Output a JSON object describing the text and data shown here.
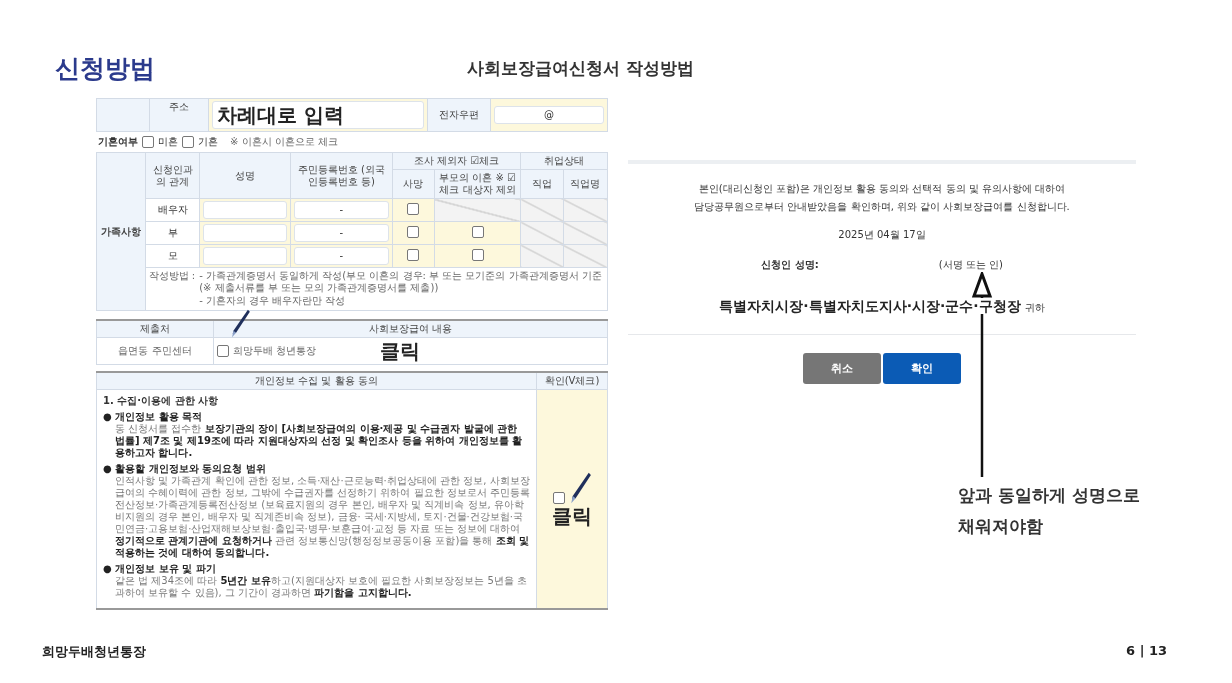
{
  "header": {
    "title": "신청방법",
    "subtitle": "사회보장급여신청서 작성방법"
  },
  "family_form": {
    "address": {
      "label": "주소",
      "annotation": "차례대로 입력"
    },
    "email": {
      "label": "전자우편",
      "value": "@"
    },
    "marital_status": {
      "label": "기혼여부",
      "options": [
        {
          "label": "미혼",
          "checked": false
        },
        {
          "label": "기혼",
          "checked": false
        }
      ],
      "note": "※ 이혼시 이혼으로 체크"
    },
    "section_label": "가족사항",
    "headers": {
      "relation": "신청인과의 관계",
      "name": "성명",
      "id_number": "주민등록번호 (외국인등록번호 등)",
      "exclusion": "조사 제외자 ☑체크",
      "deceased": "사망",
      "divorce": "부모의 이혼 ※ ☑체크 대상자 제외",
      "employment": "취업상태",
      "job": "직업",
      "job_name": "직업명"
    },
    "rows": [
      {
        "relation": "배우자",
        "id_number": "-",
        "deceased_checked": false
      },
      {
        "relation": "부",
        "id_number": "-",
        "deceased_checked": false,
        "divorce_checkbox": {
          "checked": false
        }
      },
      {
        "relation": "모",
        "id_number": "-",
        "deceased_checked": false,
        "divorce_checkbox": {
          "checked": false
        }
      }
    ],
    "note_label": "작성방법 :",
    "notes": [
      "- 가족관계증명서 동일하게 작성(부모 이혼의 경우: 부 또는 모기준의 가족관계증명서 기준 (※ 제출서류를 부 또는 모의 가족관계증명서를 제출))",
      "- 기혼자의 경우 배우자란만 작성"
    ]
  },
  "submission": {
    "headers": [
      "제출처",
      "사회보장급여 내용"
    ],
    "office": "읍면동 주민센터",
    "benefit": {
      "label": "희망두배 청년통장",
      "checked": false
    },
    "annotation": "클릭"
  },
  "consent": {
    "header": "개인정보 수집 및 활용 동의",
    "check_header": "확인(V체크)",
    "section_title": "1. 수집·이용에 관한 사항",
    "items": [
      {
        "bullet": "●",
        "title": "개인정보 활용 목적",
        "text": "동 신청서를 접수한 **보장기관의 장이 [사회보장급여의 이용·제공 및 수급권자 발굴에 관한 법률] 제7조 및 제19조에 따라 지원대상자의 선정 및 확인조사 등을 위하여 개인정보를 활용하고자 합니다.**"
      },
      {
        "bullet": "●",
        "title": "활용할 개인정보와 동의요청 범위",
        "text": "인적사항 및 가족관계 확인에 관한 정보, 소득·재산·근로능력·취업상태에 관한 정보, 사회보장급여의 수혜이력에 관한 정보, 그밖에 수급권자를 선정하기 위하여 필요한 정보로서 주민등록전산정보·가족관계등록전산정보 (보육료지원의 경우 본인, 배우자 및 직계비속 정보, 유아학비지원의 경우 본인, 배우자 및 직계존비속 정보), 금융· 국세·지방세, 토지·건물·건강보험·국민연금·고용보험·산업재해보상보험·출입국·병무·보훈급여·교정 등 자료 또는 정보에 대하여 **정기적으로 관계기관에 요청하거나** 관련 정보통신망(행정정보공동이용 포함)을 통해 **조회 및 적용하는 것에 대하여 동의합니다.**"
      },
      {
        "bullet": "●",
        "title": "개인정보 보유 및 파기",
        "text": "같은 법 제34조에 따라 **5년간 보유**하고(지원대상자 보호에 필요한 사회보장정보는 5년을 초과하여 보유할 수 있음), 그 기간이 경과하면 **파기함을 고지합니다.**"
      }
    ],
    "checked": false,
    "annotation": "클릭"
  },
  "application": {
    "statement": [
      "본인(대리신청인 포함)은 개인정보 활용 동의와 선택적 동의 및 유의사항에 대하여",
      "담당공무원으로부터 안내받았음을 확인하며, 위와 같이 사회보장급여를 신청합니다."
    ],
    "date": "2025년 04월 17일",
    "signer_label": "신청인 성명:",
    "signature_hint": "(서명 또는 인)",
    "addressee": "특별자치시장·특별자치도지사·시장·군수·구청장",
    "addressee_suffix": "귀하",
    "buttons": [
      {
        "label": "취소",
        "kind": "secondary"
      },
      {
        "label": "확인",
        "kind": "primary"
      }
    ]
  },
  "annotation": {
    "lines": [
      "앞과 동일하게 성명으로",
      "채워져야함"
    ]
  },
  "footer": {
    "brand": "희망두배청년통장",
    "page": "6 | 13"
  }
}
